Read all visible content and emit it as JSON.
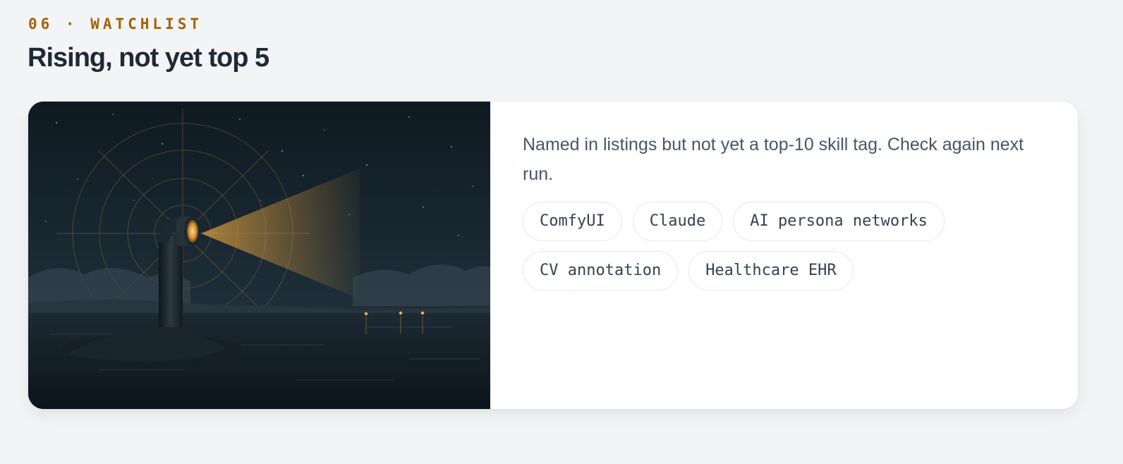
{
  "section": {
    "eyebrow": "06 · WATCHLIST",
    "title": "Rising, not yet top 5"
  },
  "card": {
    "image_alt": "Periscope at night",
    "description": "Named in listings but not yet a top-10 skill tag. Check again next run.",
    "tags": [
      "ComfyUI",
      "Claude",
      "AI persona networks",
      "CV annotation",
      "Healthcare EHR"
    ]
  },
  "colors": {
    "accent": "#a16207",
    "title": "#1f2937",
    "body_text": "#475569",
    "tag_border": "#e2e8f0",
    "page_bg": "#f3f4f6"
  }
}
